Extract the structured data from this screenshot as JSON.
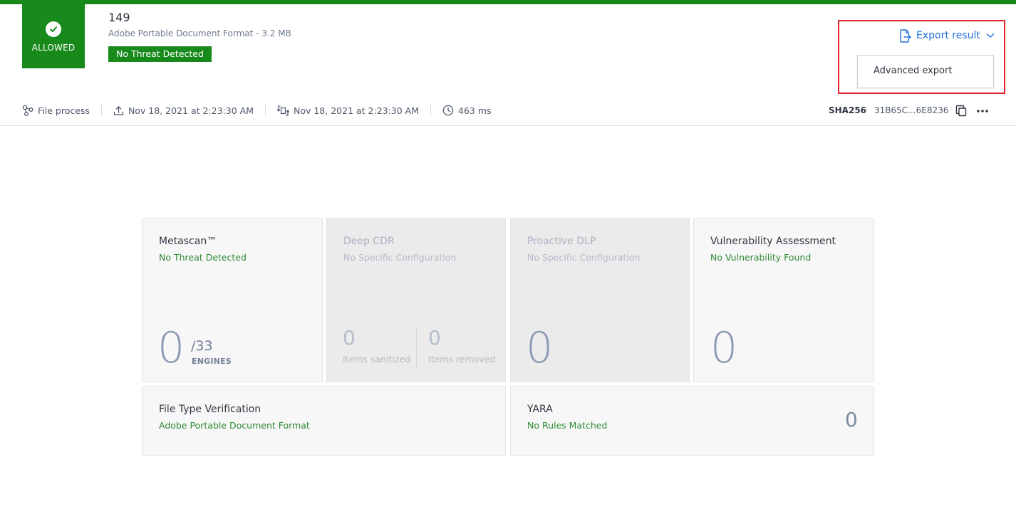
{
  "header": {
    "verdict_label": "ALLOWED",
    "file_title": "149",
    "file_subtitle": "Adobe Portable Document Format - 3.2 MB",
    "threat_badge": "No Threat Detected",
    "colors": {
      "accent_green": "#188a1c",
      "link_blue": "#1d6fdc",
      "highlight_red": "#e0222a"
    }
  },
  "export": {
    "button_label": "Export result",
    "menu_items": [
      "Advanced export"
    ]
  },
  "meta": {
    "process_label": "File process",
    "uploaded_at": "Nov 18, 2021 at 2:23:30 AM",
    "processed_at": "Nov 18, 2021 at 2:23:30 AM",
    "duration": "463 ms"
  },
  "hash": {
    "label": "SHA256",
    "value": "31B65C...6E8236"
  },
  "cards": {
    "metascan": {
      "title": "Metascan™",
      "status": "No Threat Detected",
      "count": "0",
      "total": "/33",
      "unit": "ENGINES"
    },
    "deep_cdr": {
      "title": "Deep CDR",
      "status": "No Specific Configuration",
      "sanitized_count": "0",
      "sanitized_label": "Items sanitized",
      "removed_count": "0",
      "removed_label": "Items removed"
    },
    "proactive_dlp": {
      "title": "Proactive DLP",
      "status": "No Specific Configuration",
      "count": "0"
    },
    "vulnerability": {
      "title": "Vulnerability Assessment",
      "status": "No Vulnerability Found",
      "count": "0"
    },
    "file_type": {
      "title": "File Type Verification",
      "status": "Adobe Portable Document Format"
    },
    "yara": {
      "title": "YARA",
      "status": "No Rules Matched",
      "count": "0"
    }
  }
}
